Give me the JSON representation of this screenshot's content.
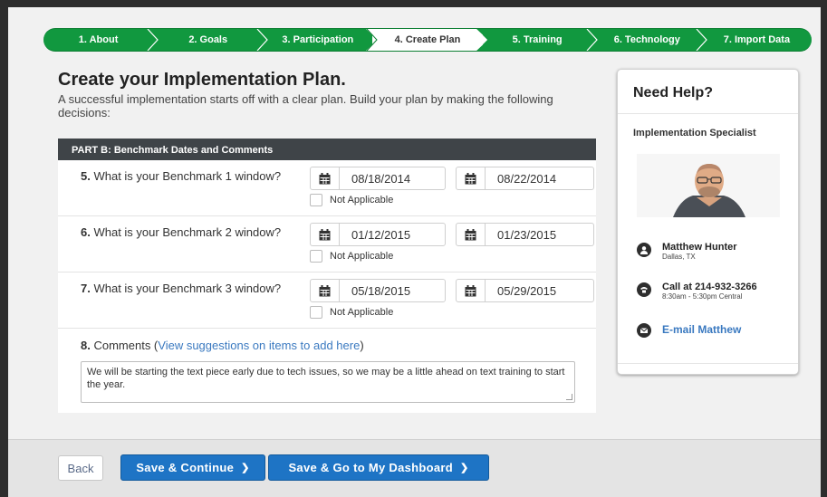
{
  "steps": [
    {
      "label": "1. About"
    },
    {
      "label": "2. Goals"
    },
    {
      "label": "3. Participation"
    },
    {
      "label": "4. Create Plan"
    },
    {
      "label": "5. Training"
    },
    {
      "label": "6. Technology"
    },
    {
      "label": "7. Import Data"
    }
  ],
  "active_step": "4. Create Plan",
  "page": {
    "title": "Create your Implementation Plan.",
    "subtitle": "A successful implementation starts off with a clear plan. Build your plan by making the following decisions:"
  },
  "part": {
    "heading": "PART B: Benchmark Dates and Comments",
    "questions": [
      {
        "num": "5.",
        "text": "What is your Benchmark 1 window?",
        "start": "08/18/2014",
        "end": "08/22/2014",
        "na_label": "Not Applicable"
      },
      {
        "num": "6.",
        "text": "What is your Benchmark 2 window?",
        "start": "01/12/2015",
        "end": "01/23/2015",
        "na_label": "Not Applicable"
      },
      {
        "num": "7.",
        "text": "What is your Benchmark 3 window?",
        "start": "05/18/2015",
        "end": "05/29/2015",
        "na_label": "Not Applicable"
      }
    ],
    "comments": {
      "num": "8.",
      "label": "Comments (",
      "link": "View suggestions on items to add here",
      "close": ")",
      "value": "We will be starting the text piece early due to tech issues, so we may be a little ahead on text training to start the year."
    }
  },
  "help": {
    "title": "Need Help?",
    "subtitle": "Implementation Specialist",
    "name": "Matthew Hunter",
    "location": "Dallas, TX",
    "phone_label": "Call at 214-932-3266",
    "hours": "8:30am - 5:30pm Central",
    "email_link": "E-mail Matthew"
  },
  "footer": {
    "back": "Back",
    "save_continue": "Save & Continue",
    "save_dashboard": "Save & Go to My Dashboard"
  },
  "colors": {
    "step_green": "#11983f",
    "button_blue": "#1e74c5",
    "link_blue": "#3a79c0",
    "panel_header": "#3f4448"
  }
}
